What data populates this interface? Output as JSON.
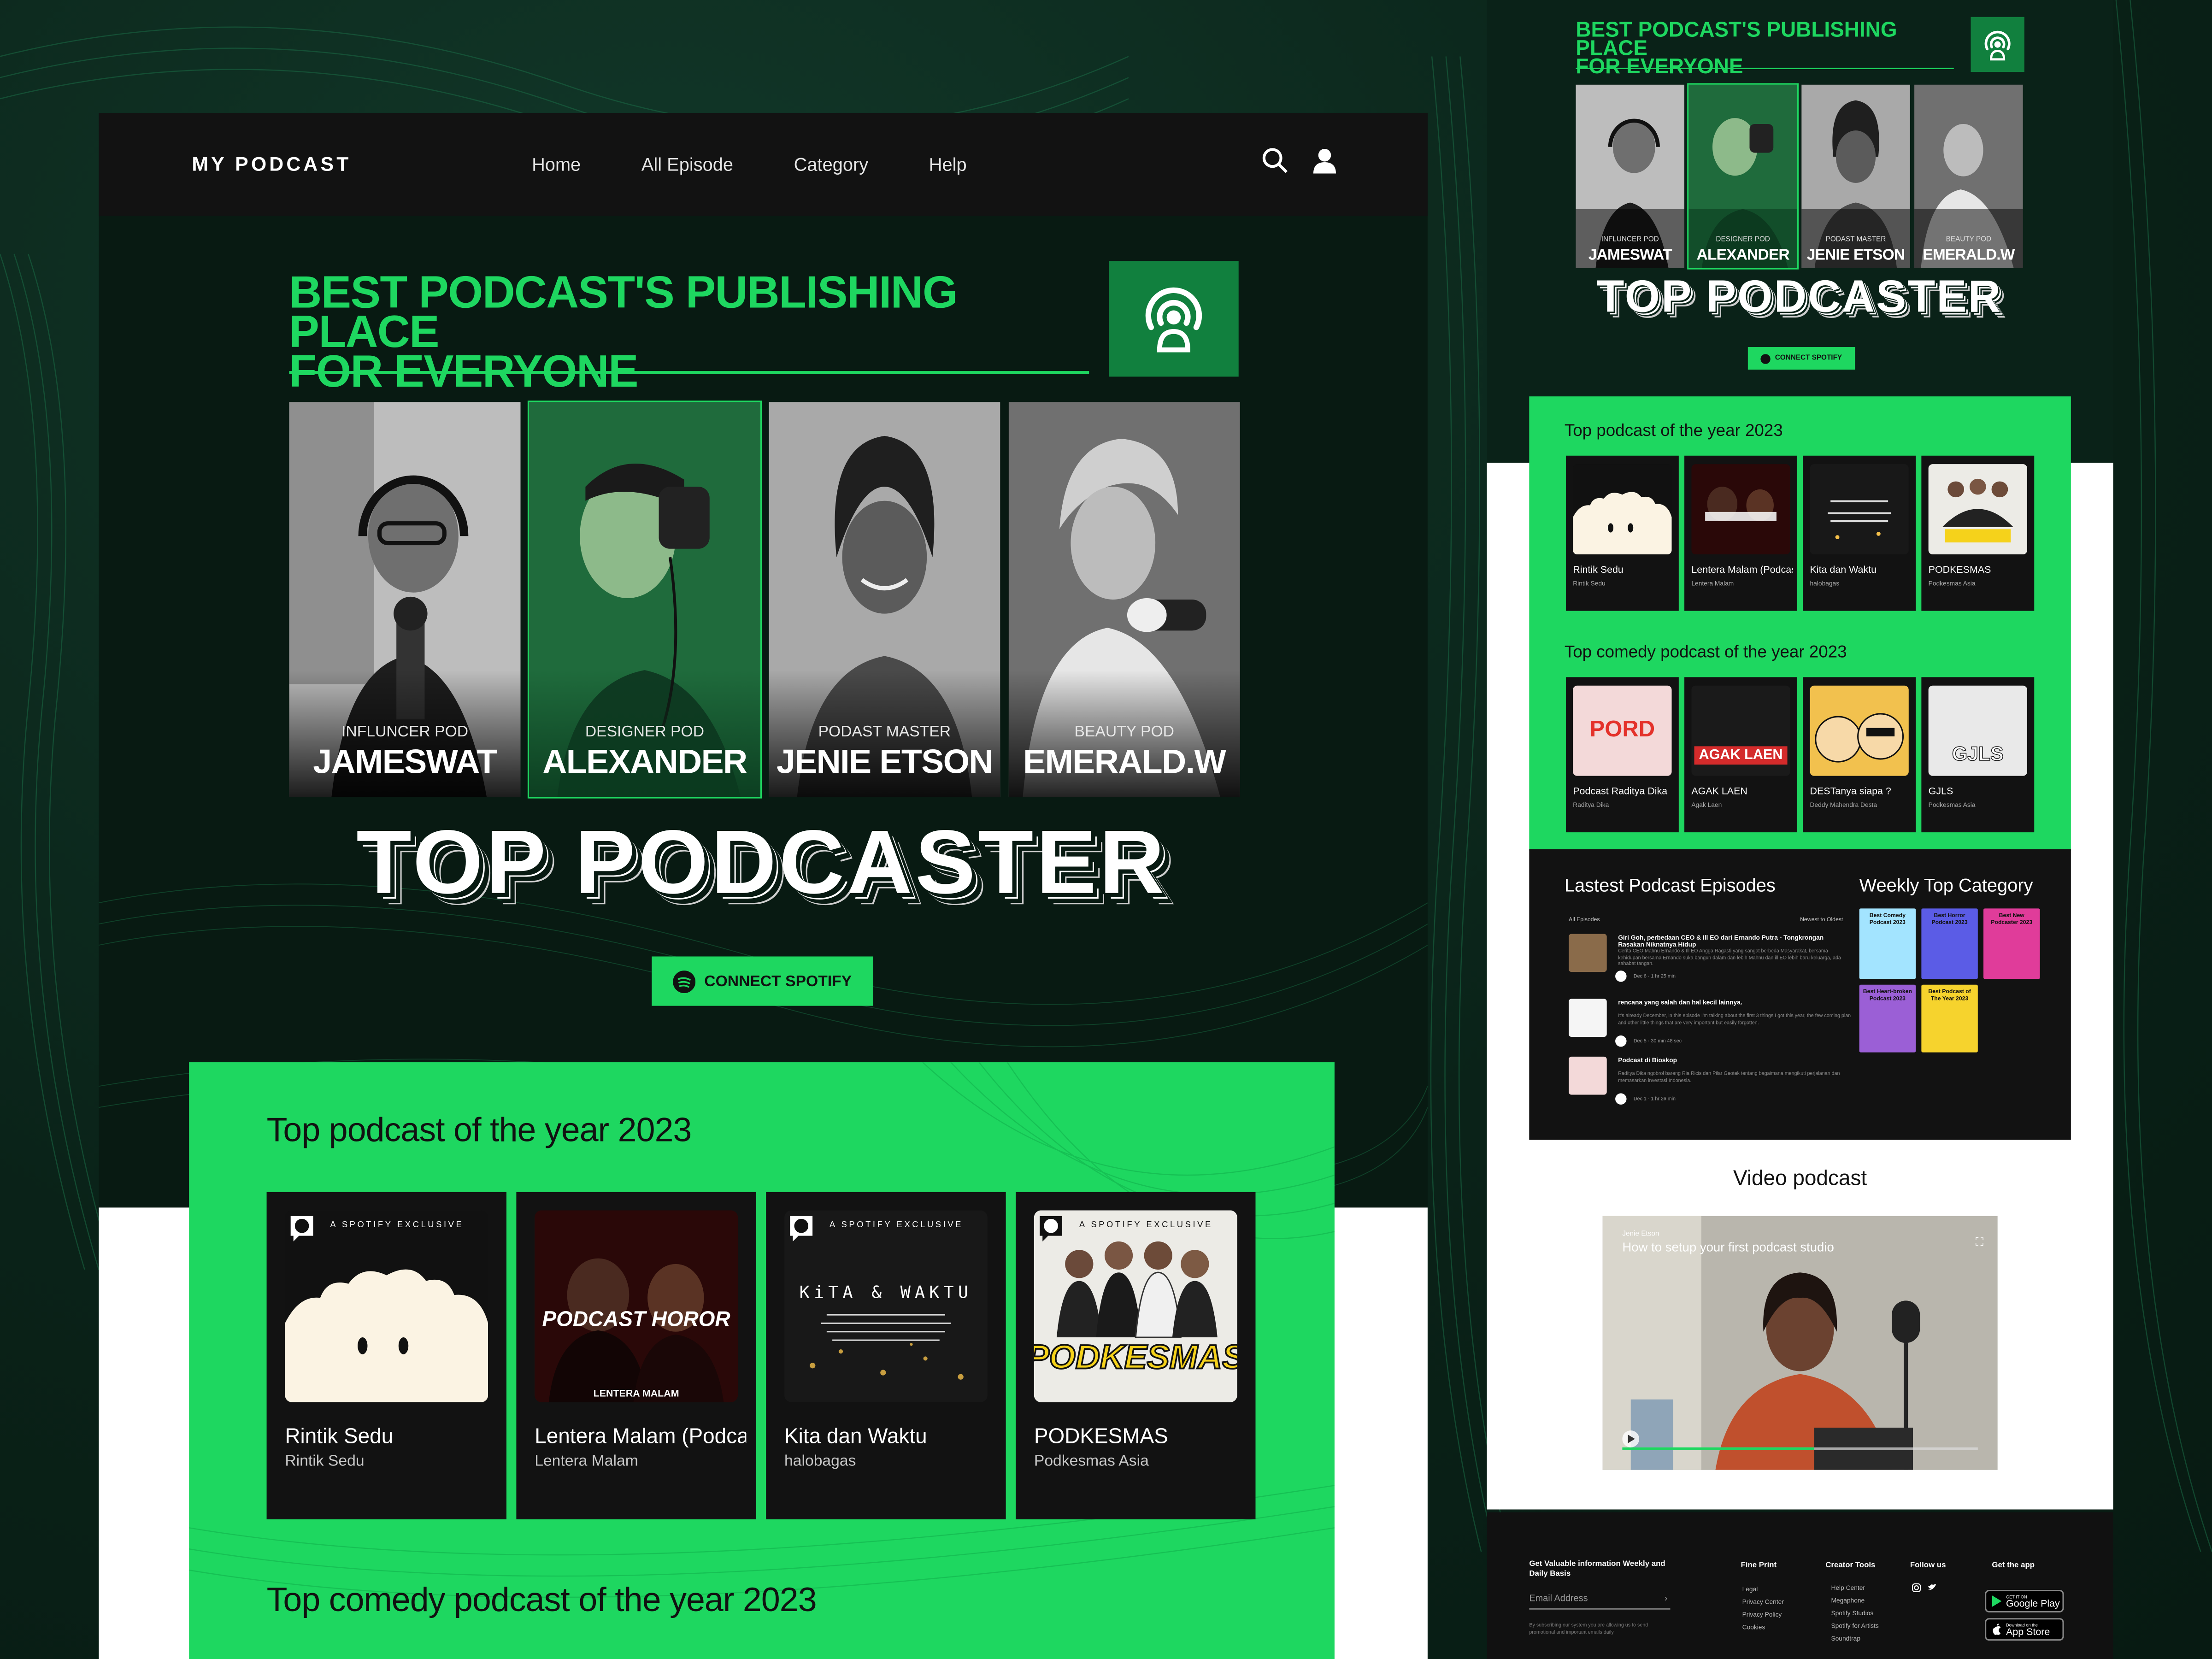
{
  "brand": {
    "logo_text": "MY PODCAST",
    "accent": "#1ed760",
    "dark": "#081a12"
  },
  "nav": {
    "items": [
      "Home",
      "All Episode",
      "Category",
      "Help"
    ]
  },
  "hero": {
    "title_line1": "BEST PODCAST'S PUBLISHING PLACE",
    "title_line2": "FOR EVERYONE",
    "big_title": "TOP PODCASTER",
    "connect_label": "CONNECT SPOTIFY"
  },
  "podcasters": [
    {
      "role": "INFLUNCER POD",
      "name": "JAMESWAT"
    },
    {
      "role": "DESIGNER POD",
      "name": "ALEXANDER"
    },
    {
      "role": "PODAST MASTER",
      "name": "JENIE ETSON"
    },
    {
      "role": "BEAUTY POD",
      "name": "EMERALD.W"
    }
  ],
  "sections": {
    "top_year": "Top podcast of the year 2023",
    "top_comedy": "Top comedy podcast of the year 2023",
    "latest": "Lastest Podcast Episodes",
    "weekly": "Weekly Top Category",
    "video": "Video podcast"
  },
  "exclusive_label": "A SPOTIFY EXCLUSIVE",
  "top_podcasts": [
    {
      "name": "Rintik Sedu",
      "author": "Rintik Sedu"
    },
    {
      "name": "Lentera Malam (Podcast Horor)",
      "author": "Lentera Malam"
    },
    {
      "name": "Kita dan Waktu",
      "author": "halobagas"
    },
    {
      "name": "PODKESMAS",
      "author": "Podkesmas Asia"
    }
  ],
  "art_text": {
    "horror": "PODCAST HOROR",
    "horror_sub": "LENTERA MALAM",
    "kita": "KiTA & WAKTU",
    "podkesmas": "PODKESMAS"
  },
  "comedy_podcasts": [
    {
      "name": "Podcast Raditya Dika",
      "author": "Raditya Dika",
      "art": "PORD"
    },
    {
      "name": "AGAK LAEN",
      "author": "Agak Laen",
      "art": "AGAK LAEN"
    },
    {
      "name": "DESTanya siapa ?",
      "author": "Deddy Mahendra Desta",
      "art": ""
    },
    {
      "name": "GJLS",
      "author": "Podkesmas Asia",
      "art": "GJLS"
    }
  ],
  "episodes_filter": {
    "left": "All Episodes",
    "right": "Newest to Oldest"
  },
  "episodes": [
    {
      "title": "Giri Goh, perbedaan CEO & Ill EO dari Ernando Putra - Tongkrongan Rasakan Niknatnya Hidup",
      "desc": "Cerita CEO Mahnu Ernando & Ill EO Angga Ragasti yang sangat berbeda Masyarakat, bersama kehidupan bersama Ernando suka bangun dalam dan lebih Mahnu dan ill EO lebih baru keluarga, ada sahabat tangan.",
      "meta": "Dec 6 · 1 hr 25 min"
    },
    {
      "title": "rencana yang salah dan hal kecil lainnya.",
      "desc": "It's already December, in this episode I'm talking about the first 3 things I got this year, the few coming plan and other little things that are very important but easily forgotten.",
      "meta": "Dec 5 · 30 min 48 sec"
    },
    {
      "title": "Podcast di Bioskop",
      "desc": "Raditya Dika ngobrol bareng Ria Ricis dan Pilar Geotek tentang bagaimana mengikuti perjalanan dan memasarkan investasi Indonesia.",
      "meta": "Dec 1 · 1 hr 26 min"
    }
  ],
  "weekly_categories": [
    {
      "label": "Best Comedy Podcast 2023",
      "color": "#a3e4ff"
    },
    {
      "label": "Best Horror Podcast 2023",
      "color": "#5b5ce6"
    },
    {
      "label": "Best New Podcaster 2023",
      "color": "#e03c9a"
    },
    {
      "label": "Best Heart-broken Podcast 2023",
      "color": "#9b5fd6"
    },
    {
      "label": "Best Podcast of The Year 2023",
      "color": "#f6d32d"
    }
  ],
  "video": {
    "author": "Jenie Etson",
    "title": "How to setup your first podcast studio"
  },
  "footer": {
    "newsletter_title": "Get Valuable information Weekly and Daily Basis",
    "email_placeholder": "Email Address",
    "newsletter_note": "By subscribing our system you are allowing us to send promotional and important emails daily",
    "fine_print_title": "Fine Print",
    "fine_print": [
      "Legal",
      "Privacy Center",
      "Privacy Policy",
      "Cookies"
    ],
    "creator_title": "Creator Tools",
    "creator": [
      "Help Center",
      "Megaphone",
      "Spotify Studios",
      "Spotify for Artists",
      "Soundtrap"
    ],
    "follow_title": "Follow us",
    "app_title": "Get the app",
    "google_small": "GET IT ON",
    "google": "Google Play",
    "apple_small": "Download on the",
    "apple": "App Store"
  }
}
